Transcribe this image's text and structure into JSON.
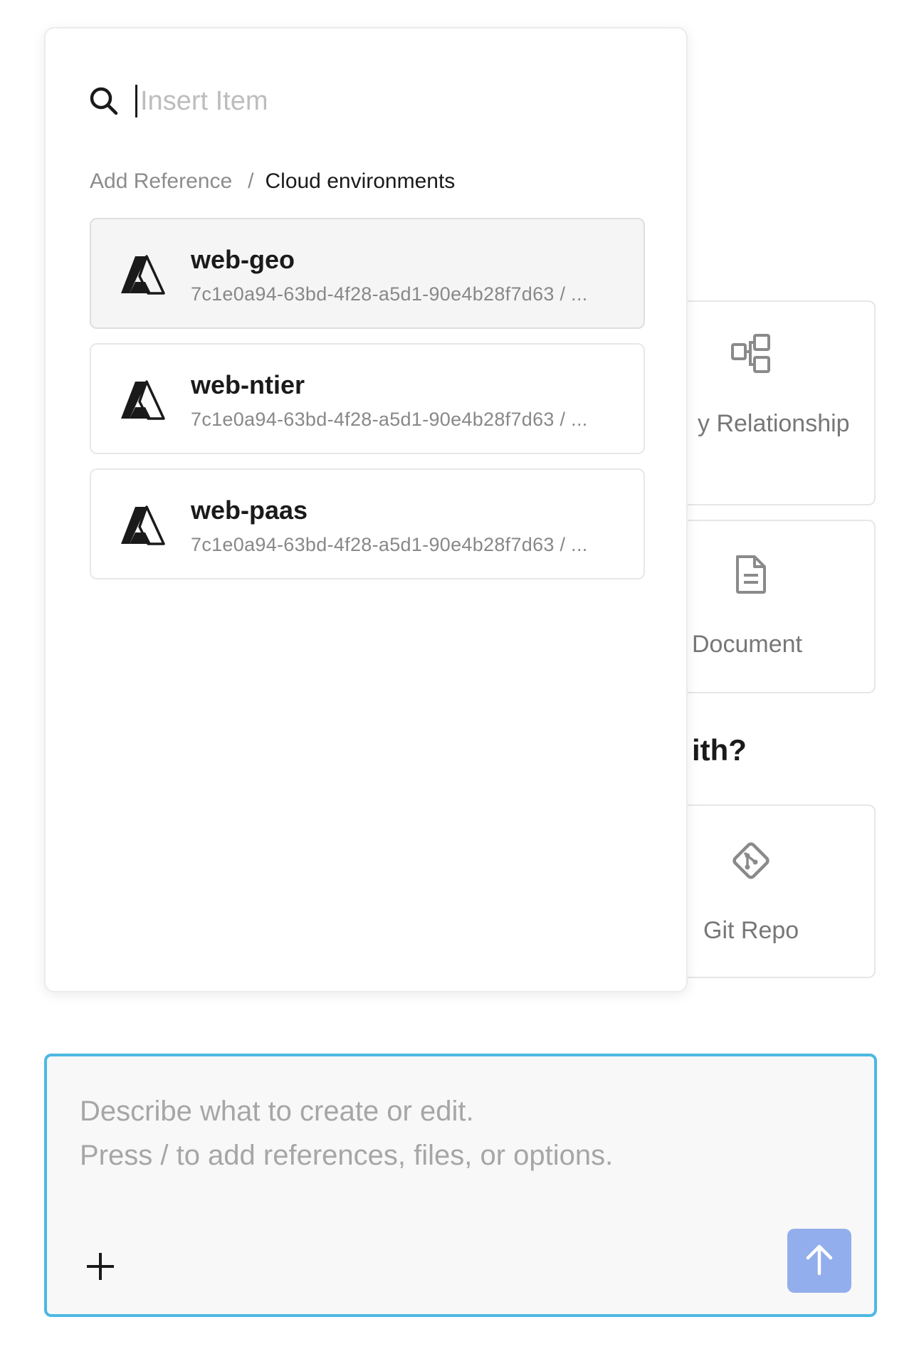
{
  "popup": {
    "search": {
      "placeholder": "Insert Item",
      "value": ""
    },
    "breadcrumb": {
      "root": "Add Reference",
      "separator": "/",
      "current": "Cloud environments"
    },
    "items": [
      {
        "name": "web-geo",
        "subtitle": "7c1e0a94-63bd-4f28-a5d1-90e4b28f7d63 / ...",
        "icon": "azure-logo-icon",
        "selected": true
      },
      {
        "name": "web-ntier",
        "subtitle": "7c1e0a94-63bd-4f28-a5d1-90e4b28f7d63 / ...",
        "icon": "azure-logo-icon",
        "selected": false
      },
      {
        "name": "web-paas",
        "subtitle": "7c1e0a94-63bd-4f28-a5d1-90e4b28f7d63 / ...",
        "icon": "azure-logo-icon",
        "selected": false
      }
    ]
  },
  "background": {
    "cards": [
      {
        "label": "y Relationship",
        "icon": "relationship-diagram-icon"
      },
      {
        "label": "Document",
        "icon": "document-icon"
      },
      {
        "label": "Git Repo",
        "icon": "git-icon"
      }
    ],
    "heading": "ith?"
  },
  "prompt": {
    "placeholder_line1": "Describe what to create or edit.",
    "placeholder_line2": "Press / to add references, files, or options.",
    "add_icon": "plus-icon",
    "send_icon": "arrow-up-icon"
  },
  "colors": {
    "accent_border": "#4cb8e2",
    "send_button": "#93aeec",
    "selected_item_bg": "#f5f5f5"
  }
}
